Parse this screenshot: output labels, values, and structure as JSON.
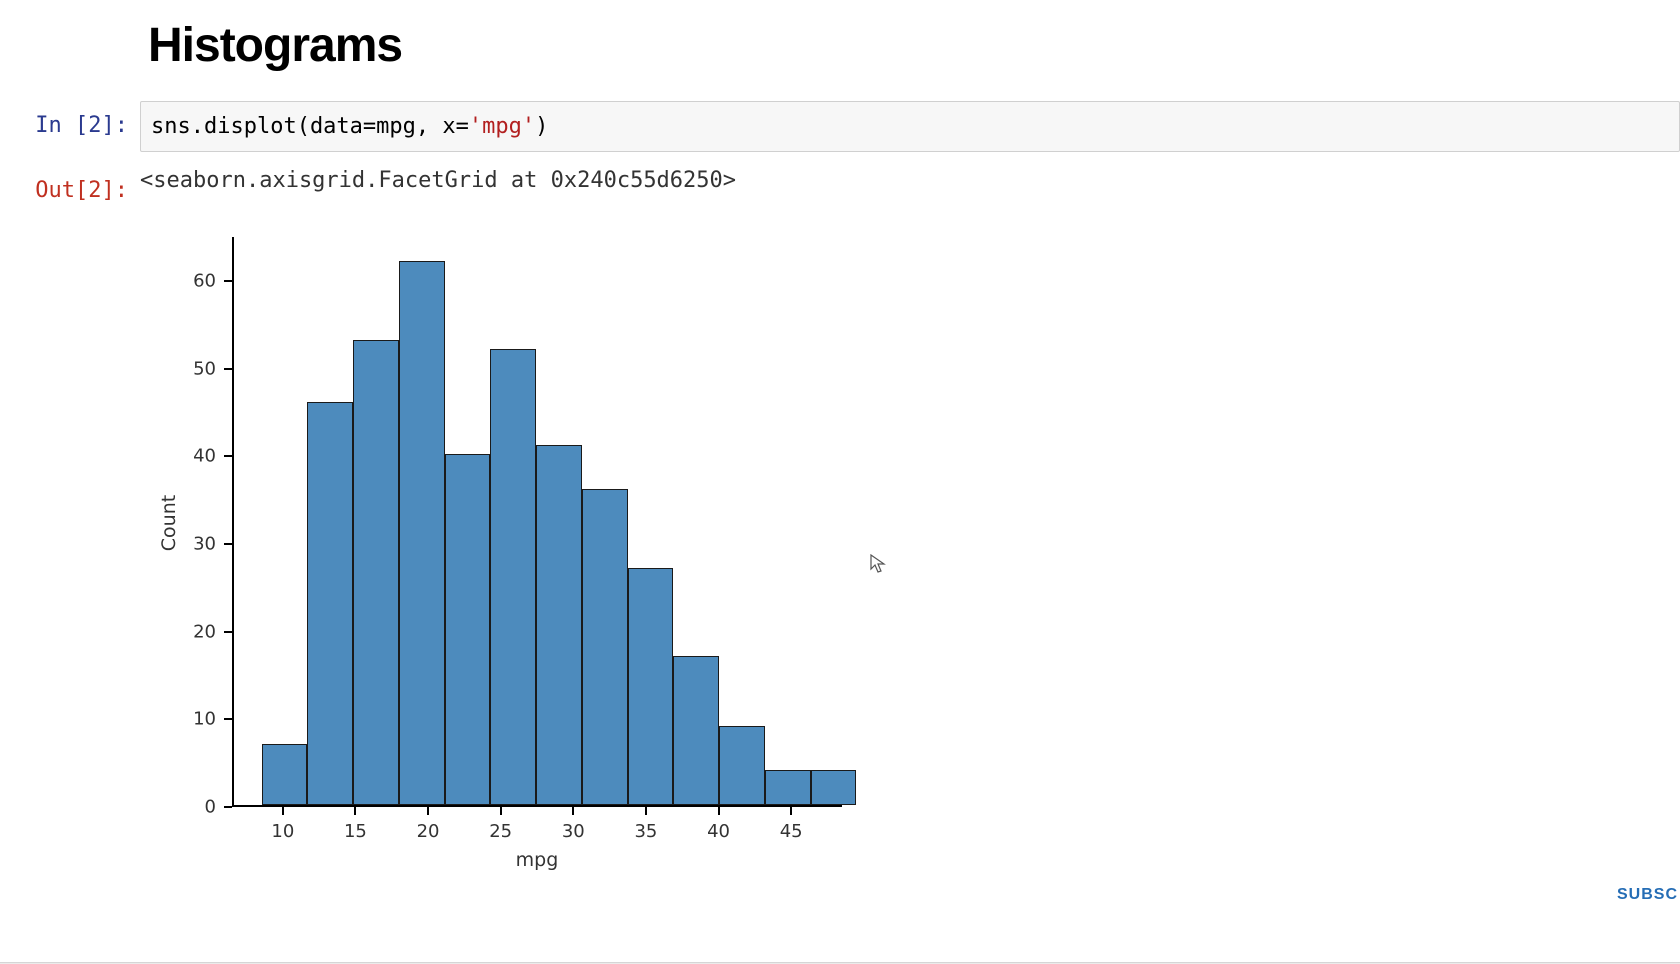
{
  "heading": "Histograms",
  "in_prompt": "In [2]:",
  "out_prompt": "Out[2]:",
  "code": {
    "prefix": "sns.displot(data",
    "eq1": "=",
    "arg1": "mpg, x",
    "eq2": "=",
    "str": "'mpg'",
    "suffix": ")"
  },
  "out_text": "<seaborn.axisgrid.FacetGrid at 0x240c55d6250>",
  "chart_data": {
    "type": "bar",
    "title": "",
    "xlabel": "mpg",
    "ylabel": "Count",
    "x_ticks": [
      10,
      15,
      20,
      25,
      30,
      35,
      40,
      45
    ],
    "y_ticks": [
      0,
      10,
      20,
      30,
      40,
      50,
      60
    ],
    "xlim": [
      6.5,
      48.5
    ],
    "ylim": [
      0,
      65
    ],
    "bin_edges": [
      8.4,
      11.55,
      14.7,
      17.85,
      21.0,
      24.15,
      27.3,
      30.45,
      33.6,
      36.75,
      39.9,
      43.05,
      46.2,
      49.35
    ],
    "values": [
      7,
      46,
      53,
      62,
      40,
      52,
      41,
      36,
      27,
      17,
      9,
      4,
      4
    ]
  },
  "corner_label": "SUBSC"
}
